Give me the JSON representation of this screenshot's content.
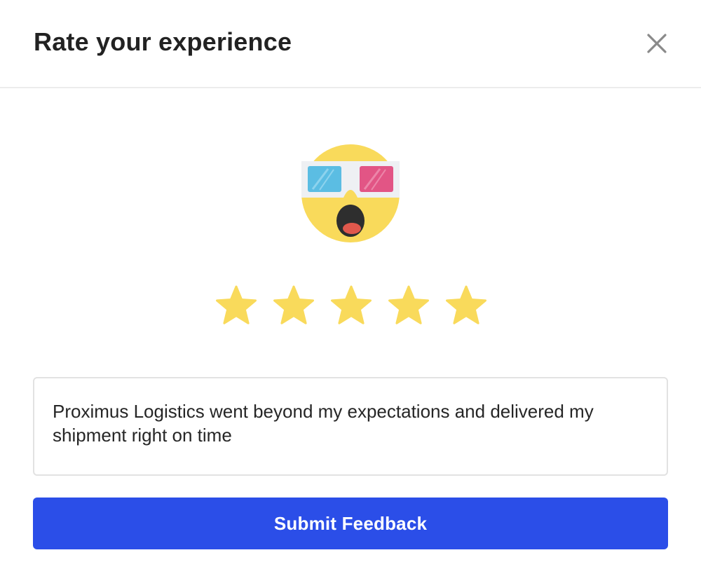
{
  "dialog": {
    "title": "Rate your experience",
    "close_icon": "close-icon"
  },
  "rating": {
    "emoji_icon": "3d-glasses-shocked-face-icon",
    "value": 5,
    "max": 5,
    "star_color": "#f9da5b"
  },
  "feedback": {
    "text": "Proximus Logistics went beyond my expectations and delivered my shipment right on time"
  },
  "submit": {
    "label": "Submit Feedback",
    "color": "#2b4ee8"
  }
}
